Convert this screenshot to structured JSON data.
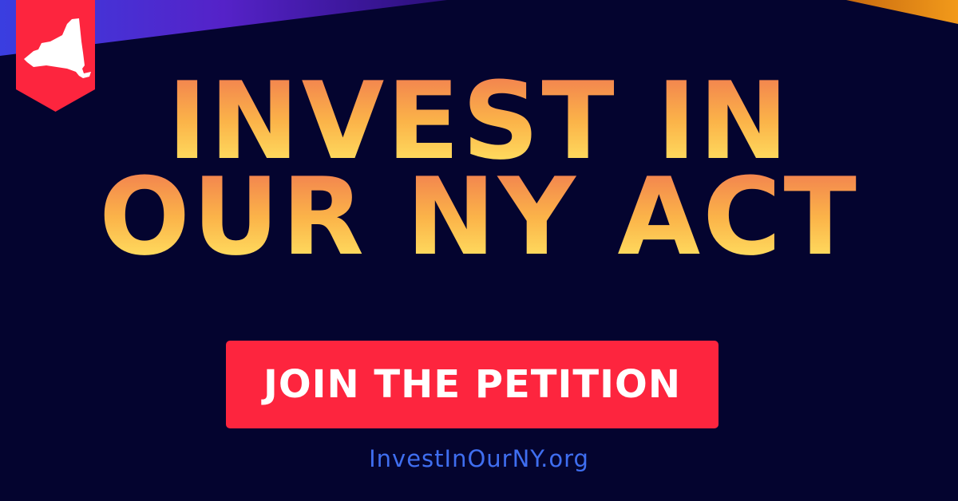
{
  "colors": {
    "background": "#04042f",
    "headline_gradient": [
      "#f2804f",
      "#fbb349",
      "#ffe362"
    ],
    "cta_background": "#fd253e",
    "cta_text": "#ffffff",
    "url_text": "#3f6ef0",
    "banner": "#fd253e"
  },
  "logo": {
    "icon": "new-york-state-icon"
  },
  "headline": {
    "line1": "INVEST IN",
    "line2": "OUR NY ACT"
  },
  "cta": {
    "label": "JOIN THE PETITION"
  },
  "site": {
    "url": "InvestInOurNY.org"
  }
}
